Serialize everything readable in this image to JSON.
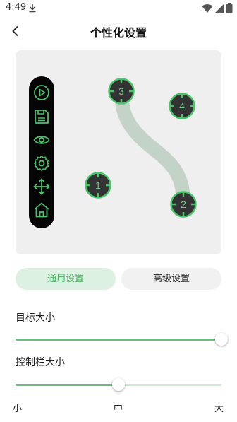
{
  "status_bar": {
    "time": "4:49"
  },
  "header": {
    "title": "个性化设置"
  },
  "toolbar": {
    "items": [
      "play-icon",
      "save-icon",
      "eye-icon",
      "settings-icon",
      "move-icon",
      "home-icon"
    ]
  },
  "points": [
    {
      "label": "3"
    },
    {
      "label": "4"
    },
    {
      "label": "1"
    },
    {
      "label": "2"
    }
  ],
  "tabs": {
    "general": "通用设置",
    "advanced": "高级设置",
    "active": "general"
  },
  "target_size": {
    "label": "目标大小",
    "value_percent": 100
  },
  "control_bar_size": {
    "label": "控制栏大小",
    "value_percent": 50
  },
  "scale_labels": {
    "small": "小",
    "medium": "中",
    "large": "大"
  },
  "colors": {
    "accent": "#66c07c",
    "tab_active_bg": "#dcf1e1",
    "toolbar_bg": "#050505",
    "path": "#c4d3c7"
  }
}
